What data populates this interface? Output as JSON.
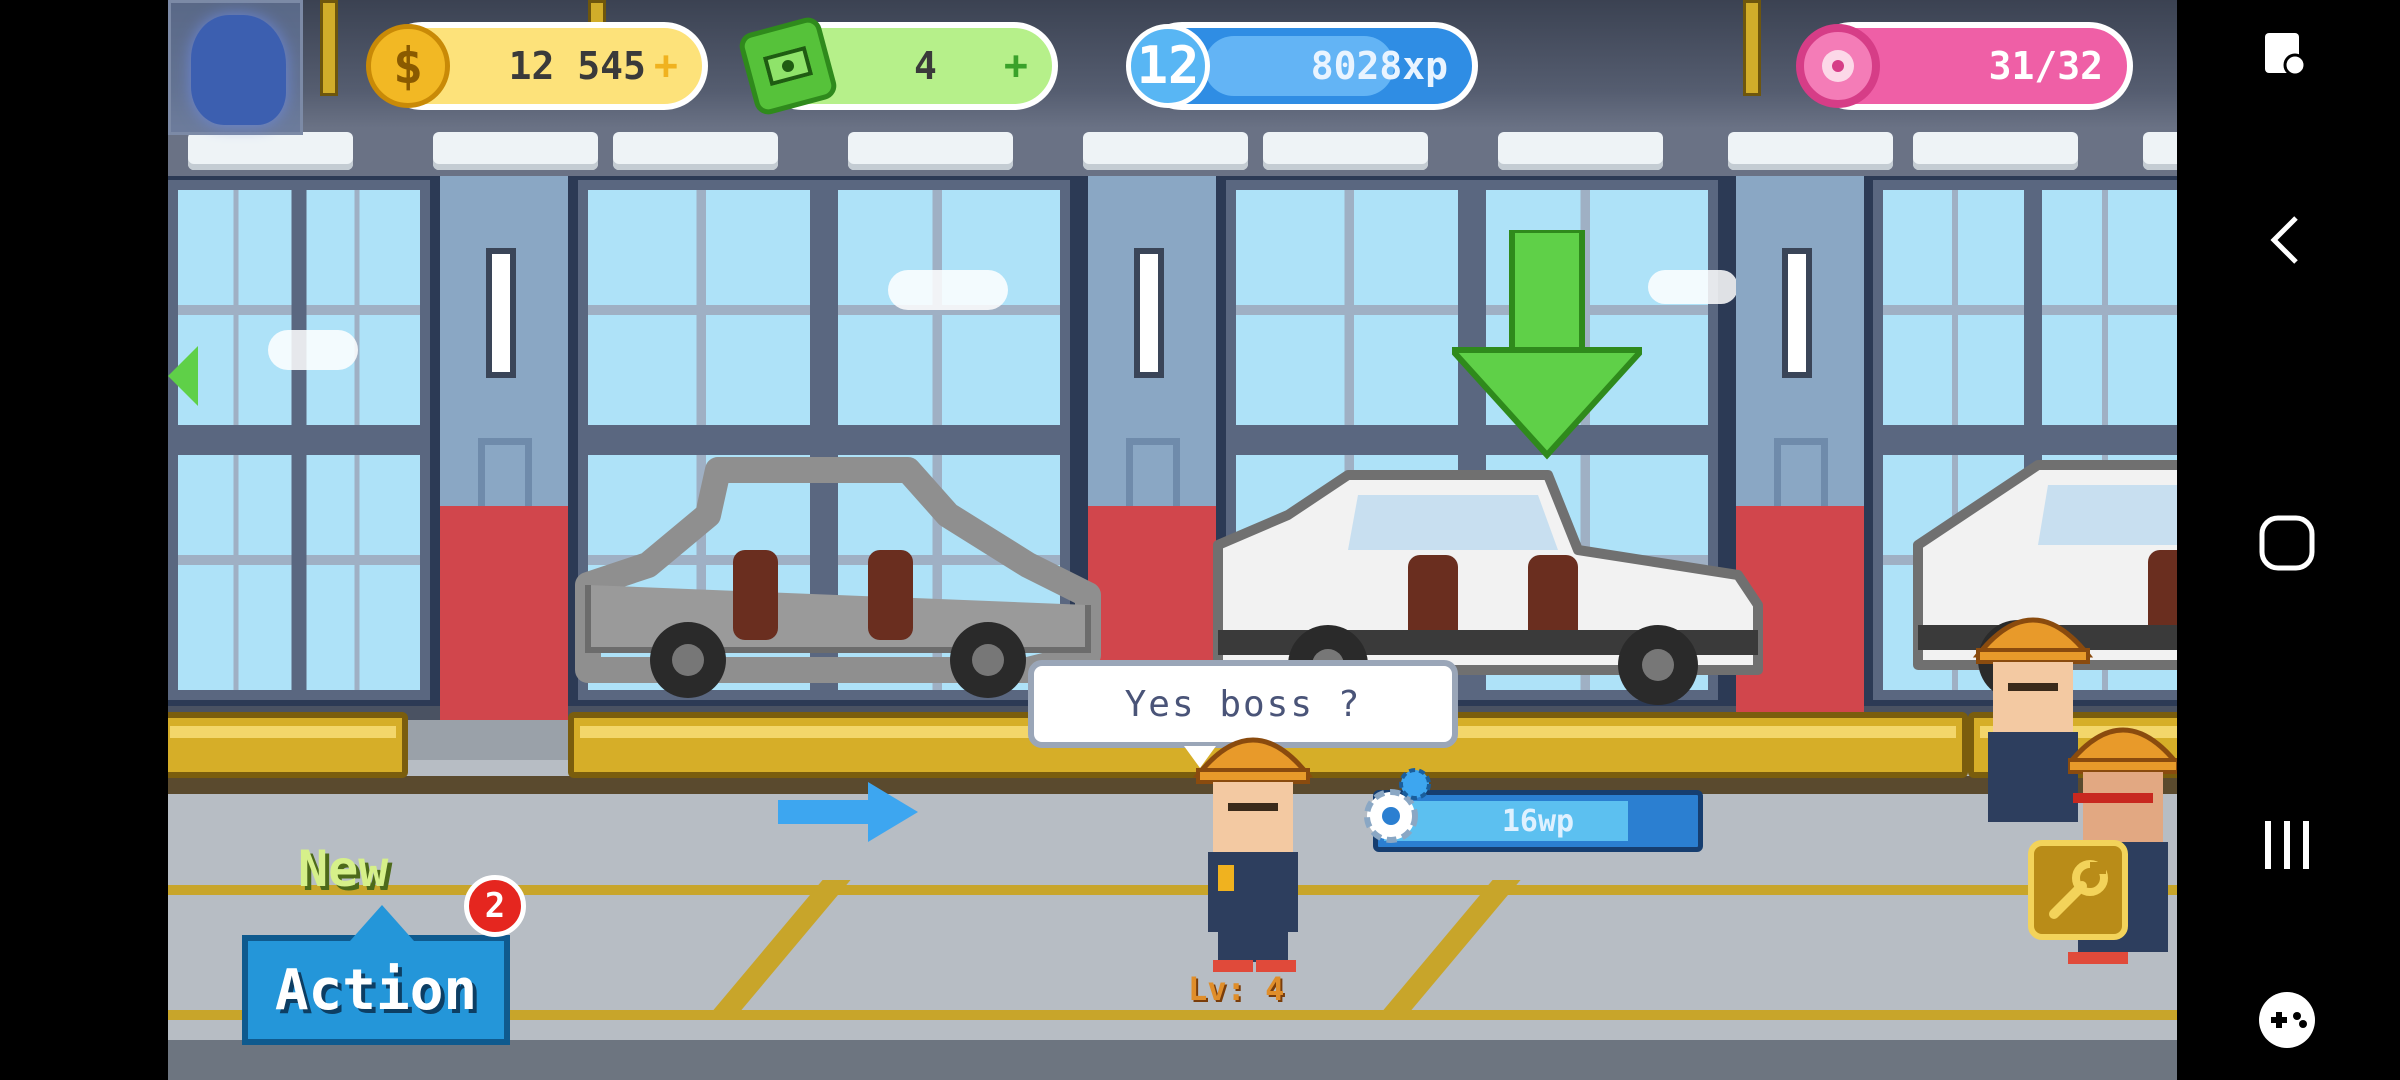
{
  "hud": {
    "coins_value": "12 545",
    "coins_plus": "+",
    "coins_icon": "$",
    "cash_value": "4",
    "cash_plus": "+",
    "level_value": "12",
    "xp_value": "8028xp",
    "xp_progress": 0.58,
    "donuts_value": "31/32"
  },
  "scene": {
    "speech_text": "Yes boss ?",
    "worker_level": "Lv: 4",
    "wp_value": "16wp",
    "wp_progress": 0.8
  },
  "actions": {
    "new_label": "New",
    "action_label": "Action",
    "badge_count": "2"
  },
  "colors": {
    "coins": "#fde27a",
    "cash": "#b6f08a",
    "xp": "#2f8de4",
    "donuts": "#ef5fa6",
    "action": "#2496d9"
  },
  "icons": {
    "coins": "coin-icon",
    "cash": "cash-icon",
    "xp": "star-level-icon",
    "donuts": "donut-icon",
    "wrench": "wrench-icon",
    "gear": "gear-icon"
  }
}
